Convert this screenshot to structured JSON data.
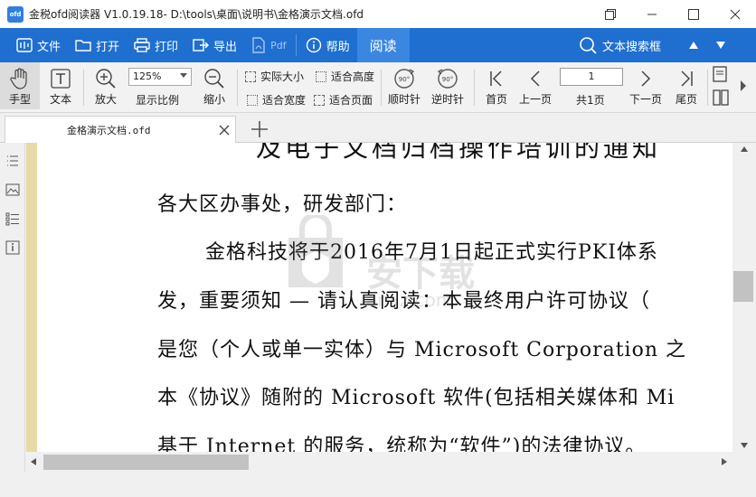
{
  "window": {
    "logo_text": "ofd",
    "title": "金税ofd阅读器 V1.0.19.18- D:\\tools\\桌面\\说明书\\金格演示文档.ofd"
  },
  "menu": {
    "file": "文件",
    "open": "打开",
    "print": "打印",
    "export": "导出",
    "pdf": "Pdf",
    "help": "帮助",
    "read": "阅读",
    "search": "文本搜索框"
  },
  "toolbar": {
    "hand": "手型",
    "text": "文本",
    "zoom_in": "放大",
    "zoom_value": "125%",
    "zoom_ratio": "显示比例",
    "zoom_out": "缩小",
    "actual_size": "实际大小",
    "fit_height": "适合高度",
    "fit_width": "适合宽度",
    "fit_page": "适合页面",
    "rotate_cw": "顺时针",
    "rotate_ccw": "逆时针",
    "first_page": "首页",
    "prev_page": "上一页",
    "page_number": "1",
    "page_total": "共1页",
    "next_page": "下一页",
    "last_page": "尾页",
    "rotate_badge": "90°"
  },
  "tabs": [
    {
      "label": "金格演示文档.ofd"
    }
  ],
  "document": {
    "title": "及电子文档归档操作培训的通知",
    "lines": [
      "各大区办事处，研发部门：",
      "金格科技将于2016年7月1日起正式实行PKI体系",
      "发，重要须知 — 请认真阅读：本最终用户许可协议（",
      "是您（个人或单一实体）与 Microsoft Corporation 之",
      "本《协议》随附的 Microsoft 软件(包括相关媒体和 Mi",
      "基于 Internet 的服务，统称为“软件”)的法律协议。"
    ]
  },
  "watermark": {
    "text": "安下载",
    "sub": "anxz.com"
  }
}
